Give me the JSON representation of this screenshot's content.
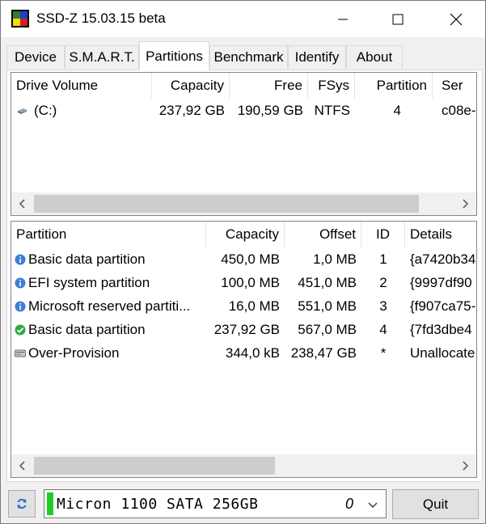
{
  "window": {
    "title": "SSD-Z 15.03.15 beta",
    "icon": "app-logo-icon"
  },
  "tabs": [
    {
      "label": "Device",
      "active": false
    },
    {
      "label": "S.M.A.R.T.",
      "active": false
    },
    {
      "label": "Partitions",
      "active": true
    },
    {
      "label": "Benchmark",
      "active": false
    },
    {
      "label": "Identify",
      "active": false
    },
    {
      "label": "About",
      "active": false
    }
  ],
  "volumes": {
    "columns": [
      "Drive Volume",
      "Capacity",
      "Free",
      "FSys",
      "Partition",
      "Ser"
    ],
    "rows": [
      {
        "icon": "drive-icon",
        "volume": "(C:)",
        "capacity": "237,92 GB",
        "free": "190,59 GB",
        "fsys": "NTFS",
        "partition": "4",
        "serial": "c08e-"
      }
    ]
  },
  "partitions": {
    "columns": [
      "Partition",
      "Capacity",
      "Offset",
      "ID",
      "Details"
    ],
    "rows": [
      {
        "icon": "info-icon",
        "name": "Basic data partition",
        "capacity": "450,0 MB",
        "offset": "1,0 MB",
        "id": "1",
        "details": "{a7420b34"
      },
      {
        "icon": "info-icon",
        "name": "EFI system partition",
        "capacity": "100,0 MB",
        "offset": "451,0 MB",
        "id": "2",
        "details": "{9997df90"
      },
      {
        "icon": "info-icon",
        "name": "Microsoft reserved partiti...",
        "capacity": "16,0 MB",
        "offset": "551,0 MB",
        "id": "3",
        "details": "{f907ca75-"
      },
      {
        "icon": "check-icon",
        "name": "Basic data partition",
        "capacity": "237,92 GB",
        "offset": "567,0 MB",
        "id": "4",
        "details": "{7fd3dbe4"
      },
      {
        "icon": "disk-icon",
        "name": "Over-Provision",
        "capacity": "344,0 kB",
        "offset": "238,47 GB",
        "id": "*",
        "details": "Unallocate"
      }
    ]
  },
  "drive_selector": {
    "name": "Micron 1100 SATA 256GB",
    "index": "0"
  },
  "buttons": {
    "quit": "Quit"
  },
  "colors": {
    "info": "#3d7fd6",
    "check": "#2fa845",
    "drive_bar": "#22cc22",
    "selected_tab": "#ffffff"
  }
}
